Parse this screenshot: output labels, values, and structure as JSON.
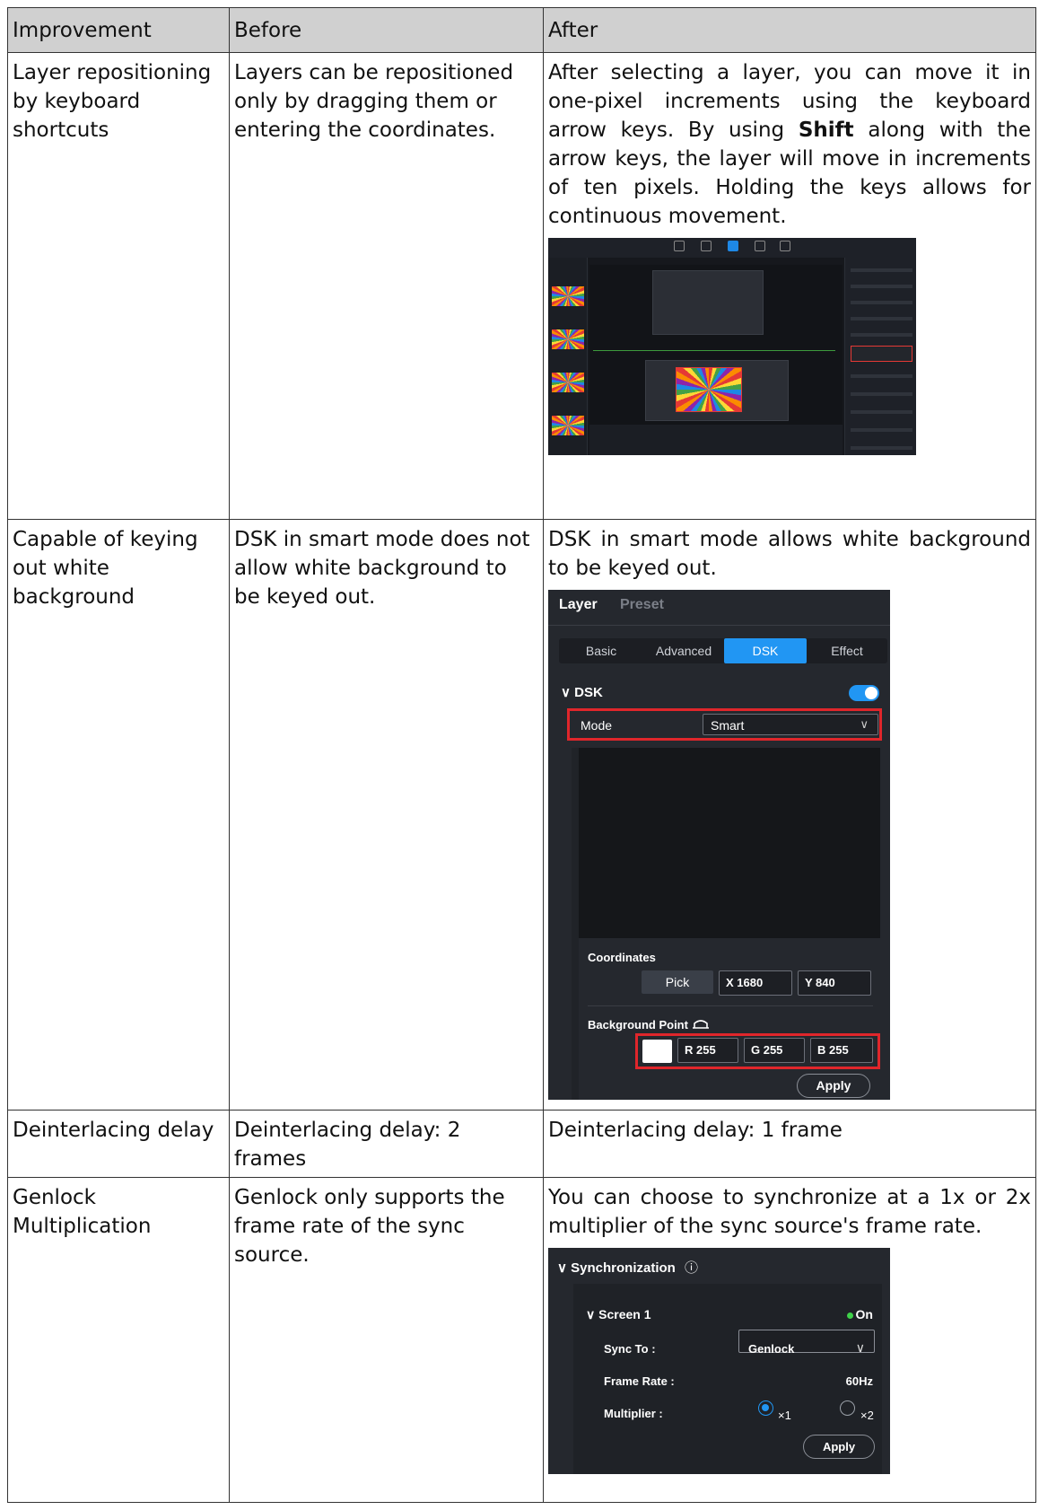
{
  "table": {
    "headers": [
      "Improvement",
      "Before",
      "After"
    ],
    "rows": [
      {
        "improvement": "Layer repositioning by keyboard shortcuts",
        "before": "Layers can be repositioned only by dragging them or entering the coordinates.",
        "after_pre": "After selecting a layer, you can move it in one-pixel increments using the keyboard arrow keys. By using ",
        "after_bold": "Shift",
        "after_post": " along with the arrow keys, the layer will move in increments of ten pixels. Holding the keys allows for continuous movement."
      },
      {
        "improvement": "Capable of keying out white background",
        "before": "DSK in smart mode does not allow white background to be keyed out.",
        "after": "DSK in smart mode allows white background to be keyed out."
      },
      {
        "improvement": "Deinterlacing delay",
        "before": "Deinterlacing delay: 2 frames",
        "after": "Deinterlacing delay: 1 frame"
      },
      {
        "improvement": "Genlock Multiplication",
        "before": "Genlock only supports the frame rate of the sync source.",
        "after": "You can choose to synchronize at a 1x or 2x multiplier of the sync source's frame rate."
      }
    ]
  },
  "dsk_panel": {
    "tab_layer": "Layer",
    "tab_preset": "Preset",
    "subtabs": [
      "Basic",
      "Advanced",
      "DSK",
      "Effect"
    ],
    "section_title": "DSK",
    "section_chevron": "∨",
    "mode_label": "Mode",
    "mode_value": "Smart",
    "chevron": "∨",
    "coordinates_label": "Coordinates",
    "pick_label": "Pick",
    "x_value": "X 1680",
    "y_value": "Y 840",
    "background_point_label": "Background Point",
    "r_value": "R 255",
    "g_value": "G 255",
    "b_value": "B 255",
    "apply_label": "Apply",
    "accent_color": "#2196f3",
    "highlight_color": "#e0262b"
  },
  "sync_panel": {
    "title": "Synchronization",
    "chevron": "∨",
    "info_icon": "ⓘ",
    "screen_label": "Screen 1",
    "status": "On",
    "sync_to_label": "Sync To :",
    "sync_to_value": "Genlock",
    "frame_rate_label": "Frame Rate :",
    "frame_rate_value": "60Hz",
    "multiplier_label": "Multiplier :",
    "multiplier_options": [
      "×1",
      "×2"
    ],
    "multiplier_selected": "×1",
    "apply_label": "Apply",
    "status_color": "#3fd14a"
  }
}
